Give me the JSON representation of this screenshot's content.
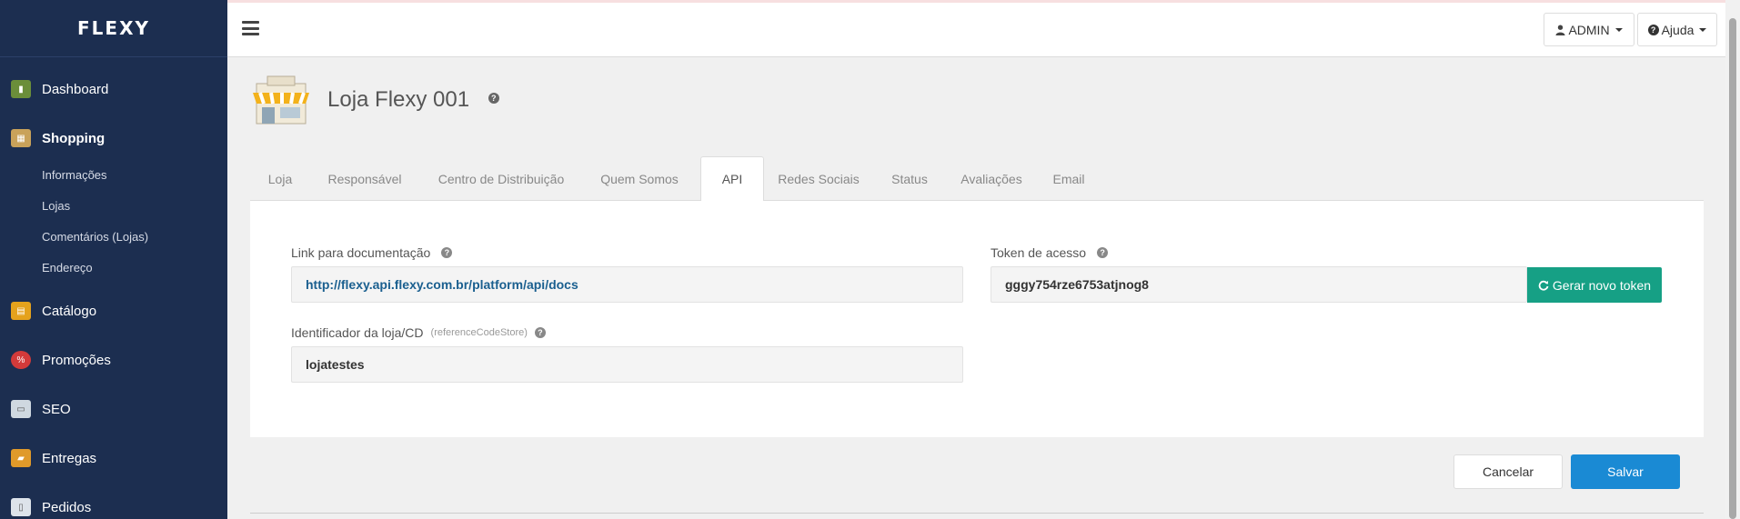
{
  "app": {
    "logo": "FLEXY"
  },
  "sidebar": {
    "items": [
      {
        "label": "Dashboard",
        "icon": "dashboard-icon",
        "color": "#6b8e3a"
      },
      {
        "label": "Shopping",
        "icon": "shopping-icon",
        "color": "#c9a25a"
      },
      {
        "label": "Catálogo",
        "icon": "catalog-icon",
        "color": "#e5a21c"
      },
      {
        "label": "Promoções",
        "icon": "promotions-icon",
        "color": "#d23a3a"
      },
      {
        "label": "SEO",
        "icon": "seo-icon",
        "color": "#cfd8e0"
      },
      {
        "label": "Entregas",
        "icon": "deliveries-icon",
        "color": "#e09a2a"
      },
      {
        "label": "Pedidos",
        "icon": "orders-icon",
        "color": "#dde3ea"
      }
    ],
    "subitems": [
      "Informações",
      "Lojas",
      "Comentários (Lojas)",
      "Endereço"
    ]
  },
  "topbar": {
    "admin_label": "ADMIN",
    "help_label": "Ajuda"
  },
  "page": {
    "title": "Loja Flexy 001"
  },
  "tabs": [
    "Loja",
    "Responsável",
    "Centro de Distribuição",
    "Quem Somos",
    "API",
    "Redes Sociais",
    "Status",
    "Avaliações",
    "Email"
  ],
  "form": {
    "doc_label": "Link para documentação",
    "doc_value": "http://flexy.api.flexy.com.br/platform/api/docs",
    "token_label": "Token de acesso",
    "token_value": "gggy754rze6753atjnog8",
    "generate_label": "Gerar novo token",
    "store_id_label": "Identificador da loja/CD",
    "store_id_hint": "(referenceCodeStore)",
    "store_id_value": "lojatestes"
  },
  "actions": {
    "cancel": "Cancelar",
    "save": "Salvar"
  },
  "colors": {
    "sidebar": "#1c2e50",
    "accent_green": "#16a085",
    "accent_blue": "#1a8ad4",
    "link": "#1a5f8f"
  }
}
